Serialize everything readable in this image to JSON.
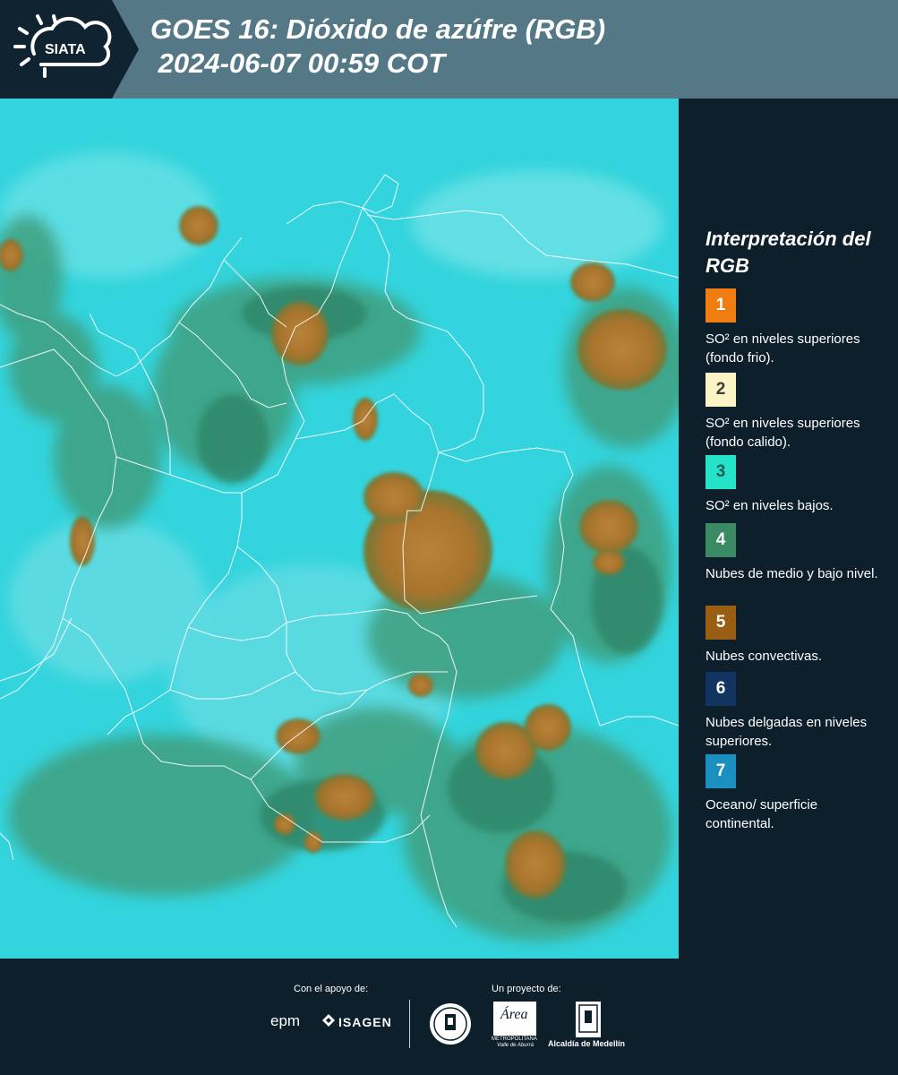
{
  "header": {
    "logo_text": "SIATA",
    "title": "GOES 16: Dióxido de azúfre (RGB)\n 2024-06-07 00:59 COT"
  },
  "legend": {
    "title": "Interpretación del RGB",
    "items": [
      {
        "number": "1",
        "label": "SO² en niveles superiores (fondo frio).",
        "color": "#f07d0f",
        "text_color": "#ffffff"
      },
      {
        "number": "2",
        "label": "SO² en niveles superiores (fondo calido).",
        "color": "#fdf4c6",
        "text_color": "#3c3c3c"
      },
      {
        "number": "3",
        "label": "SO² en niveles bajos.",
        "color": "#24e3c9",
        "text_color": "#1b5a55"
      },
      {
        "number": "4",
        "label": "Nubes de medio y bajo nivel.",
        "color": "#3a8a63",
        "text_color": "#ffffff"
      },
      {
        "number": "5",
        "label": "Nubes convectivas.",
        "color": "#9a5e12",
        "text_color": "#ffffff"
      },
      {
        "number": "6",
        "label": "Nubes delgadas en niveles superiores.",
        "color": "#113560",
        "text_color": "#ffffff"
      },
      {
        "number": "7",
        "label": "Oceano/ superficie continental.",
        "color": "#1b8fc0",
        "text_color": "#ffffff"
      }
    ]
  },
  "footer": {
    "support_label": "Con el apoyo de:",
    "project_label": "Un proyecto de:",
    "epm": "epm",
    "isagen": "ISAGEN",
    "area_name": "Área",
    "area_sub": "METROPOLITANA",
    "area_sub2": "Valle de Aburrá",
    "alcaldia": "Alcaldía de Medellín"
  },
  "colors": {
    "background": "#0c1f2b",
    "header": "#547885",
    "ocean": "#2fd3dc",
    "convective": "#b07a2c",
    "vegetation": "#3b9b7a"
  }
}
